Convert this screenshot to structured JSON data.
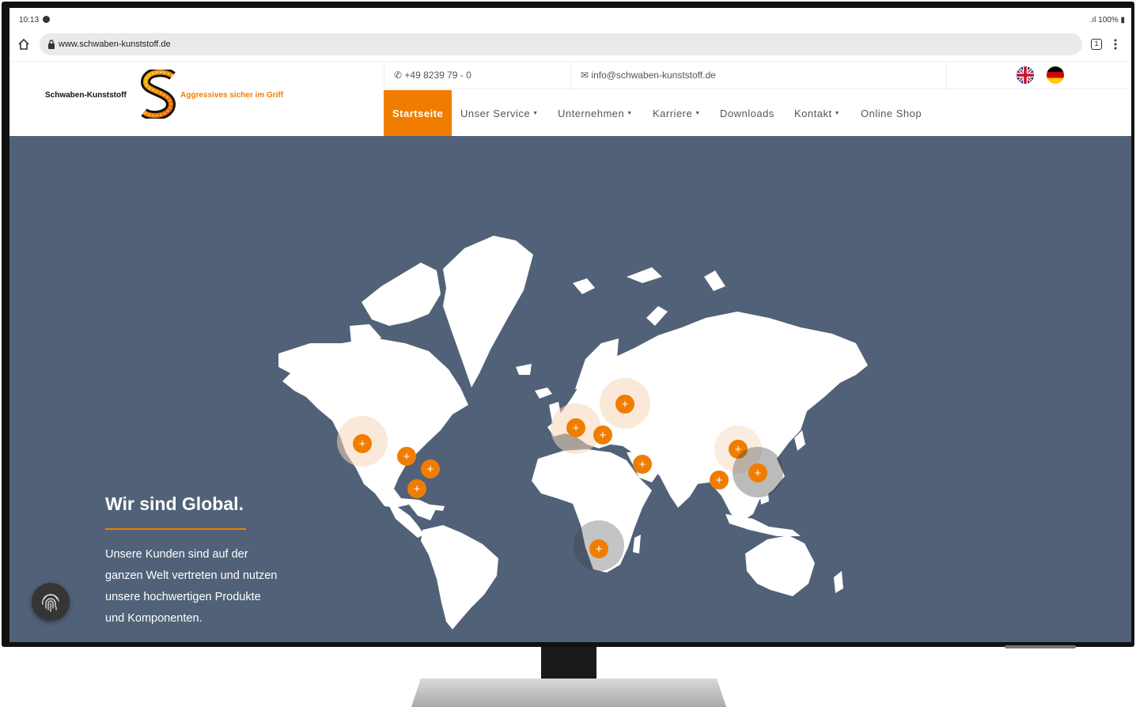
{
  "statusbar": {
    "time": "10:13",
    "battery": "100%"
  },
  "browser": {
    "url": "www.schwaben-kunststoff.de",
    "tab_count": "1"
  },
  "header": {
    "brand_name": "Schwaben-Kunststoff",
    "slogan": "Aggressives sicher im Griff",
    "phone": "+49 8239 79 - 0",
    "email": "info@schwaben-kunststoff.de",
    "languages": [
      "English",
      "Deutsch"
    ]
  },
  "nav": {
    "items": [
      {
        "label": "Startseite",
        "active": true
      },
      {
        "label": "Unser Service",
        "dropdown": true
      },
      {
        "label": "Unternehmen",
        "dropdown": true
      },
      {
        "label": "Karriere",
        "dropdown": true
      },
      {
        "label": "Downloads"
      },
      {
        "label": "Kontakt",
        "dropdown": true
      },
      {
        "label": "Online Shop"
      }
    ]
  },
  "hero": {
    "title": "Wir sind Global.",
    "text": "Unsere Kunden sind auf der ganzen Welt vertreten und nutzen unsere hochwertigen Produkte und Komponenten.",
    "marker_symbol": "+"
  },
  "colors": {
    "accent": "#f07d00",
    "map_background": "#516178",
    "land": "#ffffff"
  },
  "icons": [
    "home-icon",
    "lock-icon",
    "tabs-icon",
    "menu-icon",
    "phone-icon",
    "mail-icon",
    "uk-flag-icon",
    "de-flag-icon",
    "fingerprint-icon"
  ]
}
